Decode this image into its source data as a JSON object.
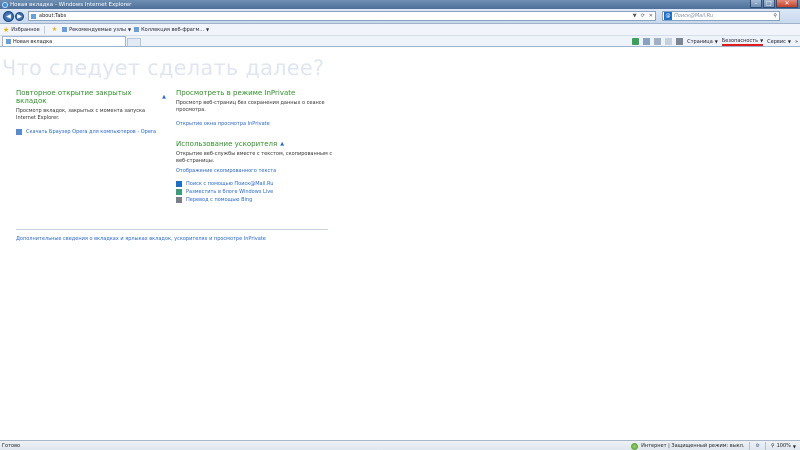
{
  "window": {
    "title": "Новая вкладка - Windows Internet Explorer"
  },
  "address": {
    "url": "about:Tabs",
    "search_placeholder": "Поиск@Mail.Ru"
  },
  "favorites": {
    "favorites_label": "Избранное",
    "suggested_sites": "Рекомендуемые узлы",
    "web_slices": "Коллекция веб-фрагм..."
  },
  "tab": {
    "label": "Новая вкладка"
  },
  "command_bar": {
    "page": "Страница",
    "safety": "Безопасность",
    "tools": "Сервис"
  },
  "content": {
    "heading": "Что следует сделать далее?",
    "reopen": {
      "title": "Повторное открытие закрытых вкладок",
      "desc": "Просмотр вкладок, закрытых с момента запуска Internet Explorer.",
      "link": "Скачать Браузер Opera для компьютеров - Opera"
    },
    "inprivate": {
      "title": "Просмотреть в режиме InPrivate",
      "desc": "Просмотр веб-страниц без сохранения данных о сеансе просмотра.",
      "link": "Открытие окна просмотра InPrivate"
    },
    "accelerators": {
      "title": "Использование ускорителя",
      "desc": "Открытие веб-службы вместе с текстом, скопированным с веб-страницы.",
      "show_copied": "Отображение скопированного текста",
      "items": [
        "Поиск с помощью Поиск@Mail.Ru",
        "Разместить в блоге Windows Live",
        "Перевод с помощью Bing"
      ]
    },
    "footer_link": "Дополнительные сведения о вкладках и ярлыках вкладок, ускорителях и просмотре InPrivate"
  },
  "status": {
    "left": "Готово",
    "zone": "Интернет | Защищенный режим: выкл.",
    "zoom": "100%"
  },
  "colors": {
    "section_title": "#2f8f2a",
    "link": "#2a67c8",
    "safety_underline": "#e01c1c"
  }
}
